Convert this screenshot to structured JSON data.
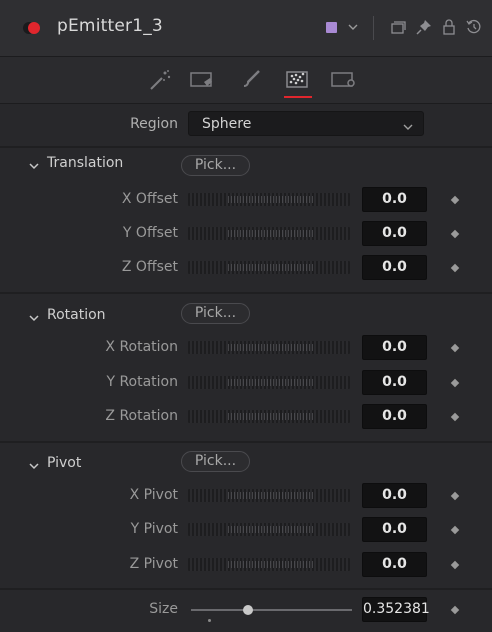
{
  "header": {
    "title": "pEmitter1_3",
    "node_color": "#a98ad4",
    "icons": [
      "enable-toggle-icon",
      "color-chevron-icon",
      "versions-icon",
      "pin-icon",
      "lock-icon",
      "reset-icon"
    ]
  },
  "tabs": [
    {
      "name": "controls-tab",
      "icon": "sparkle-wand-icon",
      "active": false
    },
    {
      "name": "set-tab",
      "icon": "tag-icon",
      "active": false
    },
    {
      "name": "style-tab",
      "icon": "brush-icon",
      "active": false
    },
    {
      "name": "region-tab",
      "icon": "particles-icon",
      "active": true
    },
    {
      "name": "settings-tab",
      "icon": "gear-box-icon",
      "active": false
    }
  ],
  "region": {
    "label": "Region",
    "value": "Sphere"
  },
  "groups": [
    {
      "title": "Translation",
      "pick": "Pick...",
      "params": [
        {
          "label": "X Offset",
          "value": "0.0"
        },
        {
          "label": "Y Offset",
          "value": "0.0"
        },
        {
          "label": "Z Offset",
          "value": "0.0"
        }
      ]
    },
    {
      "title": "Rotation",
      "pick": "Pick...",
      "params": [
        {
          "label": "X Rotation",
          "value": "0.0"
        },
        {
          "label": "Y Rotation",
          "value": "0.0"
        },
        {
          "label": "Z Rotation",
          "value": "0.0"
        }
      ]
    },
    {
      "title": "Pivot",
      "pick": "Pick...",
      "params": [
        {
          "label": "X Pivot",
          "value": "0.0"
        },
        {
          "label": "Y Pivot",
          "value": "0.0"
        },
        {
          "label": "Z Pivot",
          "value": "0.0"
        }
      ]
    }
  ],
  "size": {
    "label": "Size",
    "value": "0.352381"
  },
  "colors": {
    "accent": "#e0262d",
    "panel": "#28282b",
    "field": "#121213"
  }
}
